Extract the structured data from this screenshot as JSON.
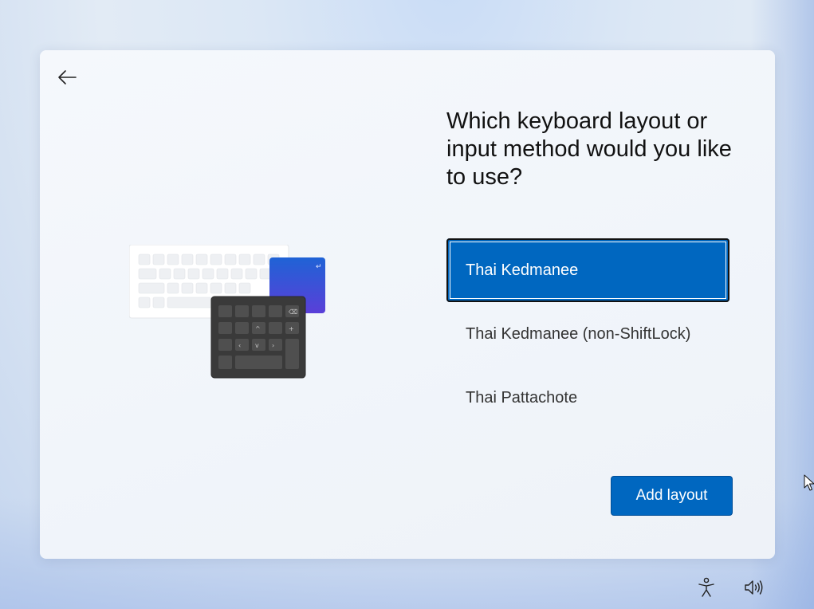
{
  "dialog": {
    "heading": "Which keyboard layout or input method would you like to use?",
    "options": [
      {
        "label": "Thai Kedmanee",
        "selected": true
      },
      {
        "label": "Thai Kedmanee (non-ShiftLock)",
        "selected": false
      },
      {
        "label": "Thai Pattachote",
        "selected": false
      }
    ],
    "add_button_label": "Add layout"
  },
  "icons": {
    "back": "arrow-left-icon",
    "accessibility": "accessibility-icon",
    "volume": "volume-icon"
  },
  "colors": {
    "accent": "#0067c0",
    "selection_border": "#111111"
  }
}
